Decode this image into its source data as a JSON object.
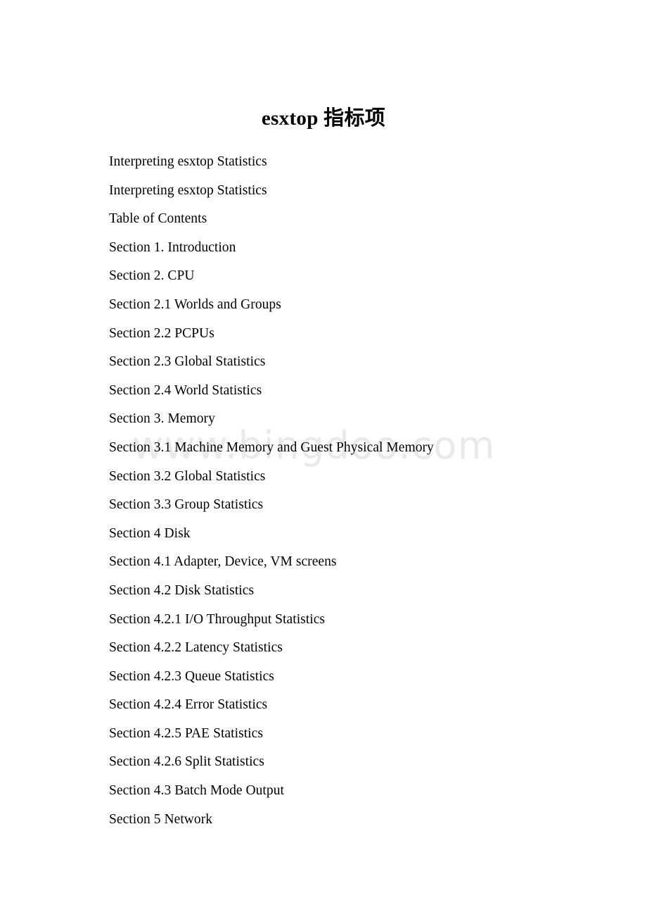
{
  "document": {
    "title": "esxtop 指标项",
    "watermark": "www.bingdoo.com",
    "watermark_color": "#e9e9e9",
    "background_color": "#ffffff",
    "text_color": "#000000",
    "lines": [
      "Interpreting esxtop Statistics",
      "Interpreting esxtop Statistics",
      "Table of Contents",
      "Section 1. Introduction",
      "Section 2. CPU",
      "Section 2.1 Worlds and Groups",
      "Section 2.2 PCPUs",
      "Section 2.3 Global Statistics",
      "Section 2.4 World Statistics",
      "Section 3. Memory",
      "Section 3.1 Machine Memory and Guest Physical Memory",
      "Section 3.2 Global Statistics",
      "Section 3.3 Group Statistics",
      "Section 4 Disk",
      "Section 4.1 Adapter, Device, VM screens",
      "Section 4.2 Disk Statistics",
      "Section 4.2.1 I/O Throughput Statistics",
      "Section 4.2.2 Latency Statistics",
      "Section 4.2.3 Queue Statistics",
      "Section 4.2.4 Error Statistics",
      "Section 4.2.5 PAE Statistics",
      "Section 4.2.6 Split Statistics",
      "Section 4.3 Batch Mode Output",
      "Section 5 Network"
    ]
  }
}
